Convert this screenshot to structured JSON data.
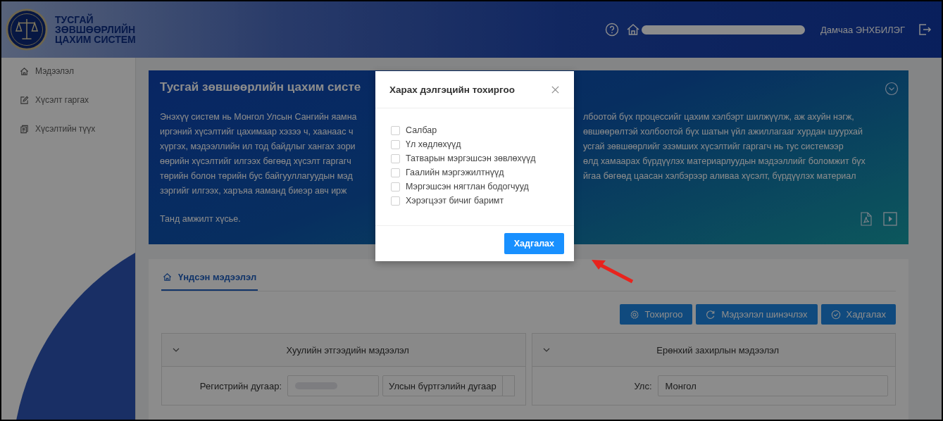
{
  "header": {
    "logo_text": [
      "ТУСГАЙ",
      "ЗӨВШӨӨРЛИЙН",
      "ЦАХИМ СИСТЕМ"
    ],
    "user_name": "Дамчаа ЭНХБИЛЭГ"
  },
  "sidebar": {
    "items": [
      {
        "kind": "home",
        "label": "Мэдээлэл"
      },
      {
        "kind": "edit",
        "label": "Хүсэлт гаргах"
      },
      {
        "kind": "history",
        "label": "Хүсэлтийн түүх"
      }
    ]
  },
  "banner": {
    "title": "Тусгай зөвшөөрлийн цахим систе",
    "lines": [
      {
        "left": "Энэхүү систем нь Монгол Улсын Сангийн яамна",
        "right": "лбоотой бүх процессийг цахим хэлбэрт шилжүүлж, аж ахуйн нэгж,"
      },
      {
        "left": "иргэний хүсэлтийг цахимаар хэзээ ч, хаанаас ч",
        "right": "өвшөөрөлтэй холбоотой бүх шатын үйл ажиллагааг хурдан шуурхай"
      },
      {
        "left": "хүргэх, мэдээллийн ил тод байдлыг хангах зори",
        "right": "усгай зөвшөөрлийг эзэмших хүсэлтийг гаргагч нь тус системээр"
      },
      {
        "left": "өөрийн хүсэлтийг илгээх бөгөөд хүсэлт гаргагч",
        "right": "өлд хамаарах бүрдүүлэх материарлуудын мэдээллийг боломжит бүх"
      },
      {
        "left": "төрийн болон төрийн бус байгууллагуудын мэд",
        "right": "йгаа бөгөөд цаасан хэлбэрээр аливаа хүсэлт, бүрдүүлэх материал"
      },
      {
        "left": "зэргийг илгээх, харъяа яаманд биеэр авч ирж"
      }
    ],
    "closing": "Танд амжилт хүсье."
  },
  "tabs": [
    {
      "label": "Үндсэн мэдээлэл",
      "selected": true
    }
  ],
  "toolbar": [
    {
      "kind": "settings",
      "label": "Тохиргоо"
    },
    {
      "kind": "refresh",
      "label": "Мэдээлэл шинэчлэх"
    },
    {
      "kind": "save",
      "label": "Хадгалах"
    }
  ],
  "panels": [
    {
      "title": "Хуулийн этгээдийн мэдээлэл",
      "fields": [
        {
          "label": "Регистрийн дугаар:",
          "redacted": true,
          "extra": "Улсын бүртгэлийн дугаар"
        }
      ]
    },
    {
      "title": "Ерөнхий захирлын мэдээлэл",
      "fields": [
        {
          "label": "Улс:",
          "redacted": false,
          "value": "Монгол"
        }
      ]
    }
  ],
  "dialog": {
    "title": "Харах дэлгэцийн тохиргоо",
    "options": [
      {
        "label": "Салбар",
        "checked": false
      },
      {
        "label": "Үл хөдлөхүүд",
        "checked": false
      },
      {
        "label": "Татварын мэргэшсэн зөвлөхүүд",
        "checked": false
      },
      {
        "label": "Гаалийн мэргэжилтнүүд",
        "checked": false
      },
      {
        "label": "Мэргэшсэн нягтлан бодогчууд",
        "checked": false
      },
      {
        "label": "Хэрэгцээт бичиг баримт",
        "checked": false
      }
    ],
    "button": "Хадгалах"
  }
}
